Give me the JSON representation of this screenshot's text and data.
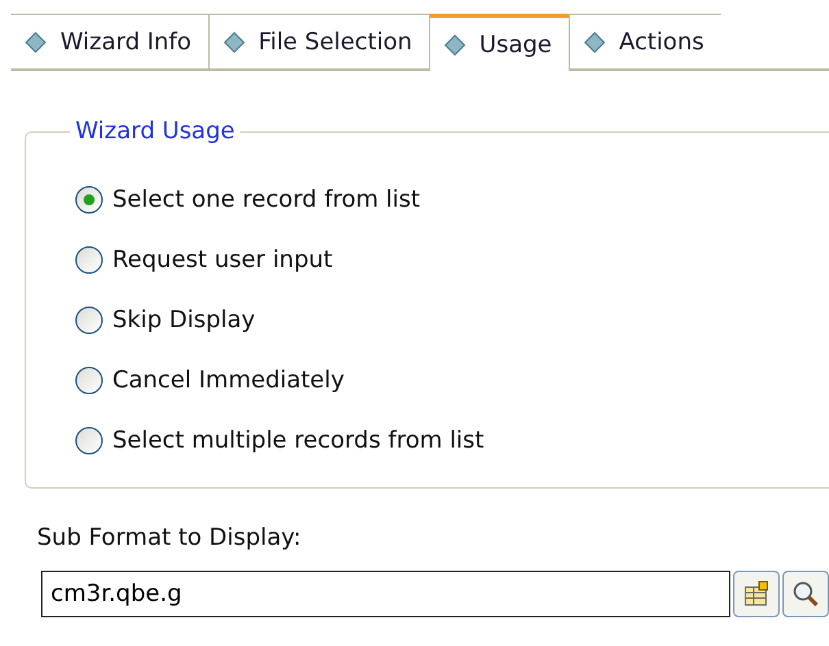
{
  "tabs": [
    {
      "label": "Wizard Info",
      "selected": false
    },
    {
      "label": "File Selection",
      "selected": false
    },
    {
      "label": "Usage",
      "selected": true
    },
    {
      "label": "Actions",
      "selected": false
    }
  ],
  "group": {
    "title": "Wizard Usage",
    "options": [
      {
        "label": "Select one record from list",
        "selected": true
      },
      {
        "label": "Request user input",
        "selected": false
      },
      {
        "label": "Skip Display",
        "selected": false
      },
      {
        "label": "Cancel Immediately",
        "selected": false
      },
      {
        "label": "Select multiple records from list",
        "selected": false
      }
    ]
  },
  "sub_format": {
    "label": "Sub Format to Display:",
    "value": "cm3r.qbe.g"
  }
}
